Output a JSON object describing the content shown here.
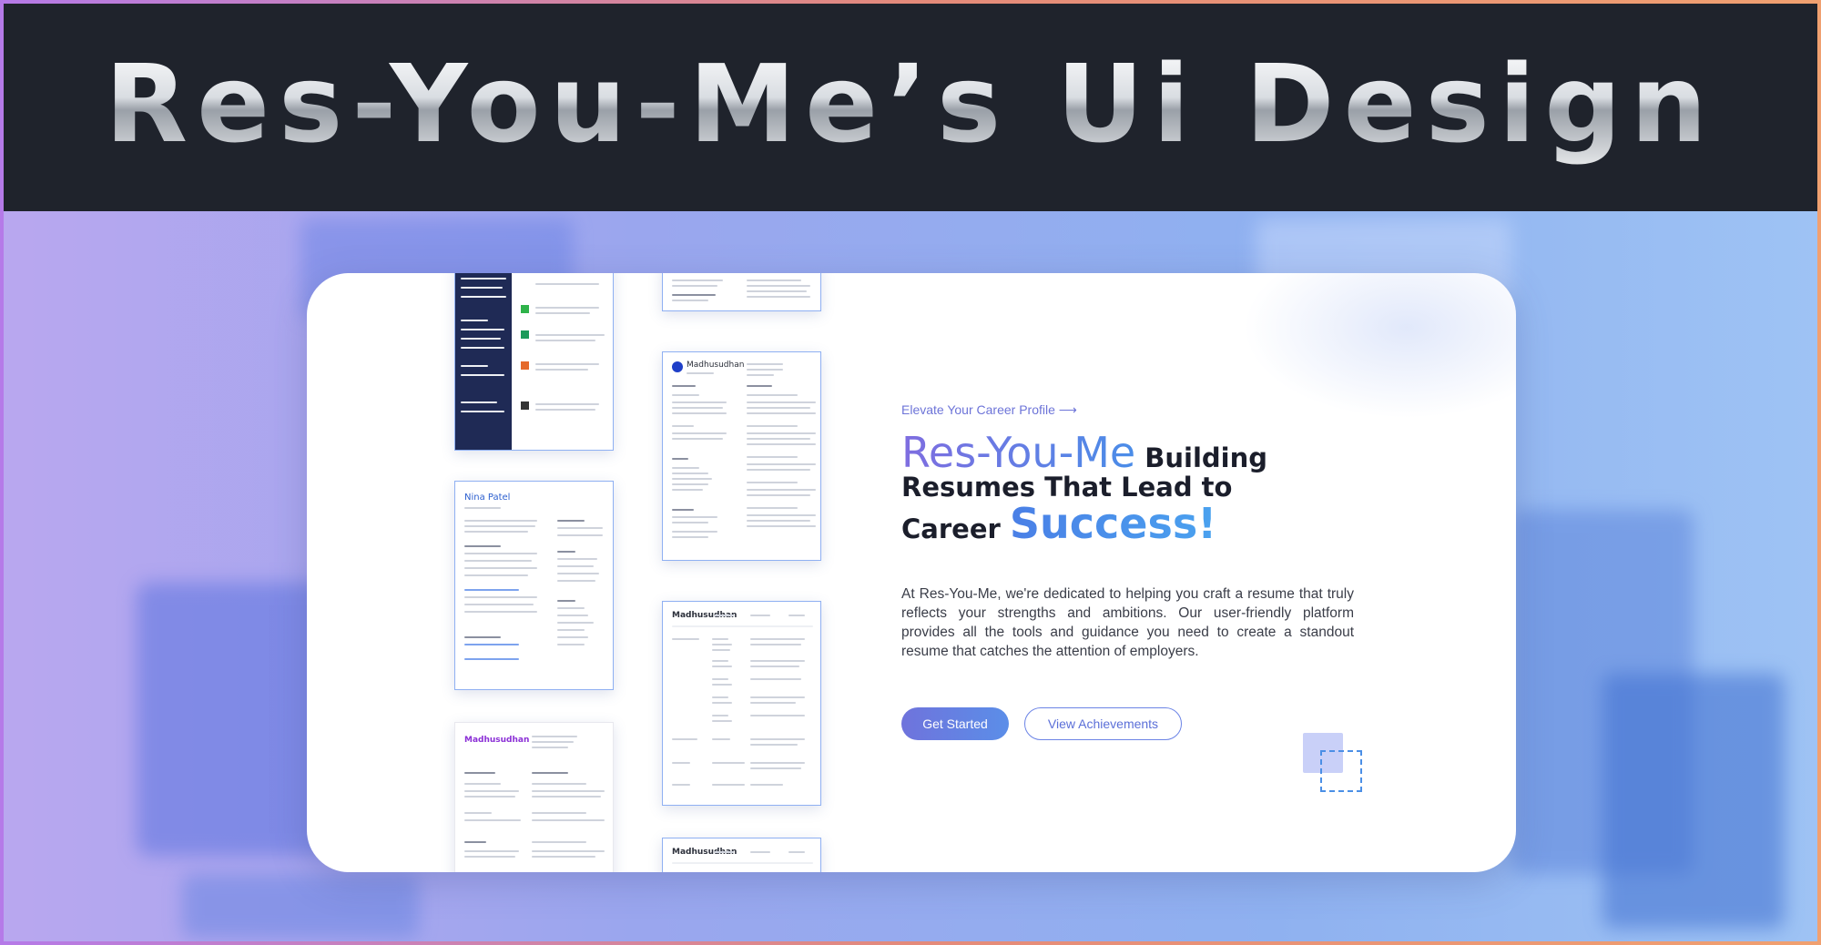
{
  "banner": {
    "title": "Res-You-Me’s Ui Design"
  },
  "hero": {
    "eyebrow": "Elevate Your Career Profile ⟶",
    "brand": "Res-You-Me",
    "line1_rest": " Building",
    "line2": "Resumes That Lead to",
    "line3_pre": "Career ",
    "line3_accent": "Success!",
    "description": "At Res-You-Me, we're dedicated to helping you craft a resume that truly reflects your strengths and ambitions. Our user-friendly platform provides all the tools and guidance you need to create a standout resume that catches the attention of employers.",
    "primary_button": "Get Started",
    "secondary_button": "View Achievements"
  },
  "thumbnails": {
    "t2_name": "Nina Patel",
    "t3_name": "Madhusudhan",
    "t5_name": "Madhusudhan",
    "t6_name": "Madhusudhan",
    "t7_name": "Madhusudhan"
  },
  "colors": {
    "banner_bg": "#1f232c",
    "accent_start": "#7f6de0",
    "accent_end": "#4a8de8"
  }
}
